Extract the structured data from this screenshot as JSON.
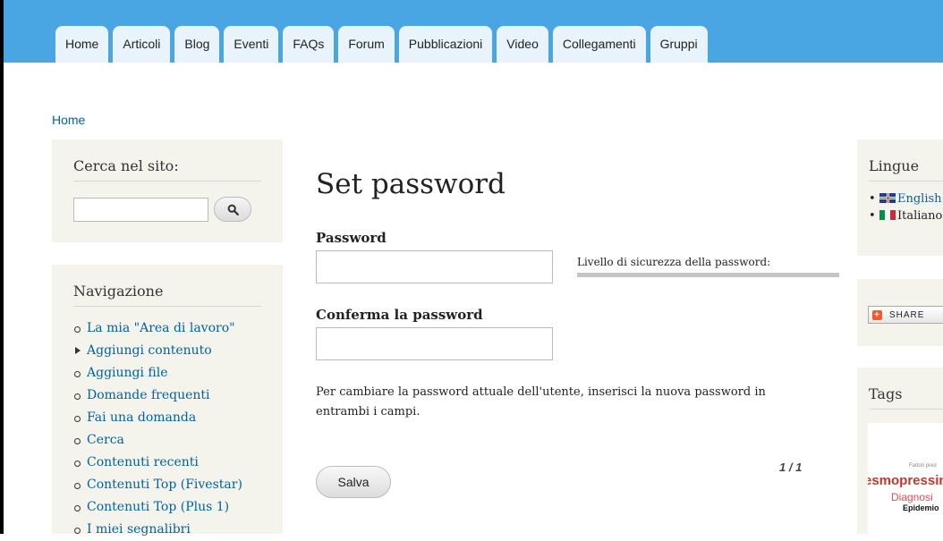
{
  "nav_tabs": [
    "Home",
    "Articoli",
    "Blog",
    "Eventi",
    "FAQs",
    "Forum",
    "Pubblicazioni",
    "Video",
    "Collegamenti",
    "Gruppi"
  ],
  "breadcrumb": "Home",
  "search_block": {
    "title": "Cerca nel sito:",
    "input_value": "",
    "button_icon": "search-icon"
  },
  "navigation_block": {
    "title": "Navigazione",
    "items": [
      "La mia \"Area di lavoro\"",
      "Aggiungi contenuto",
      "Aggiungi file",
      "Domande frequenti",
      "Fai una domanda",
      "Cerca",
      "Contenuti recenti",
      "Contenuti Top (Fivestar)",
      "Contenuti Top (Plus 1)",
      "I miei segnalibri"
    ]
  },
  "main": {
    "title": "Set password",
    "password_label": "Password",
    "password_value": "",
    "strength_label": "Livello di sicurezza della password:",
    "confirm_label": "Conferma la password",
    "confirm_value": "",
    "description": "Per cambiare la password attuale dell'utente, inserisci la nuova password in entrambi i campi.",
    "pager": "1 / 1",
    "save_label": "Salva"
  },
  "languages_block": {
    "title": "Lingue",
    "items": [
      "English",
      "Italiano"
    ]
  },
  "share": {
    "label": "SHARE"
  },
  "tags_block": {
    "title": "Tags",
    "cloud": [
      "Fattori pred",
      "esmopressin",
      "Diagnosi",
      "Epidemio"
    ]
  },
  "colors": {
    "header": "#4aa6e2",
    "tab": "#e8f3fb",
    "link": "#0062a0",
    "sidebar_bg": "#f4f4ed"
  }
}
